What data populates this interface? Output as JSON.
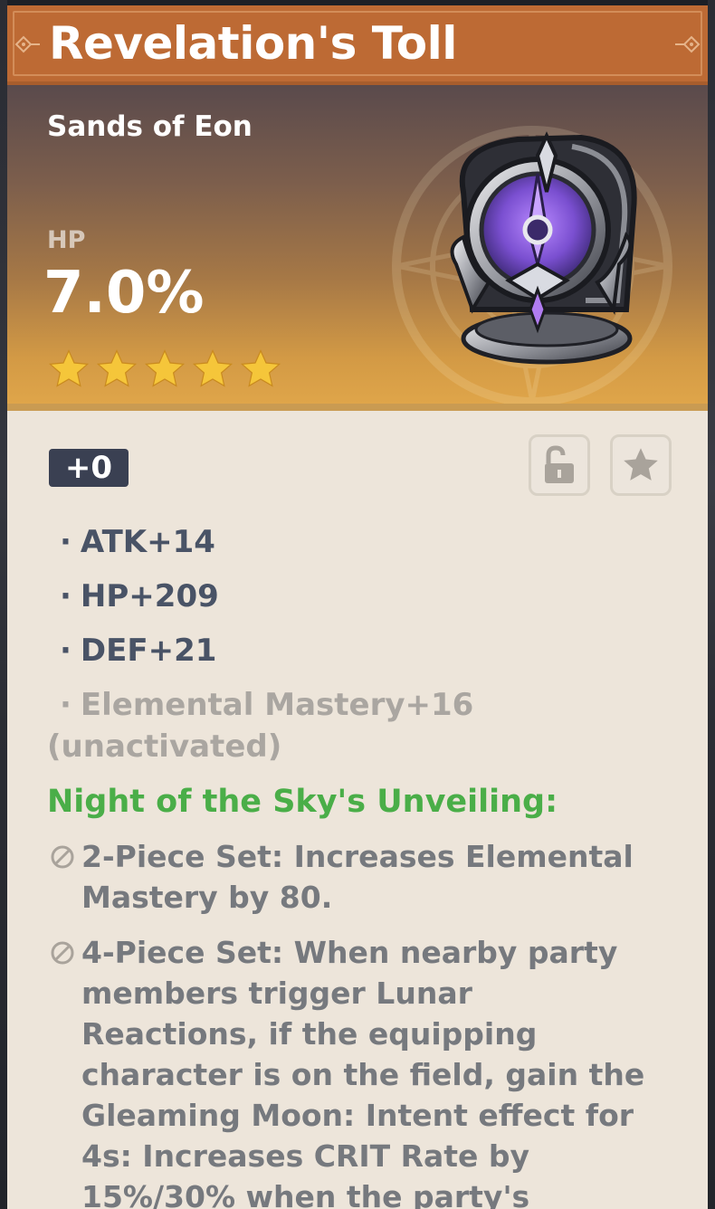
{
  "artifact": {
    "name": "Revelation's Toll",
    "piece_type": "Sands of Eon",
    "main_stat": {
      "label": "HP",
      "value": "7.0%"
    },
    "rarity_stars": 5,
    "level": "+0",
    "locked": false,
    "favorite": false
  },
  "substats": [
    {
      "text": "ATK+14",
      "active": true
    },
    {
      "text": "HP+209",
      "active": true
    },
    {
      "text": "DEF+21",
      "active": true
    },
    {
      "text": "Elemental Mastery+16",
      "active": false,
      "suffix": "(unactivated)"
    }
  ],
  "set": {
    "name": "Night of the Sky's Unveiling:",
    "effects": [
      {
        "lines": [
          "2-Piece Set: Increases Elemental",
          "Mastery by 80."
        ]
      },
      {
        "lines": [
          "4-Piece Set: When nearby party",
          "members trigger Lunar",
          "Reactions, if the equipping",
          "character is on the field, gain the",
          "Gleaming Moon: Intent effect for",
          "4s: Increases CRIT Rate by",
          "15%/30% when the party's"
        ]
      }
    ]
  },
  "bullet": "·",
  "colors": {
    "title_bar": "#bd6a34",
    "set_name": "#4aae48",
    "star": "#f5c63a",
    "active_text": "#495366",
    "inactive_text": "#aaa6a1"
  },
  "icons": [
    "lock-open-icon",
    "star-icon",
    "disabled-icon",
    "ornament-icon"
  ]
}
